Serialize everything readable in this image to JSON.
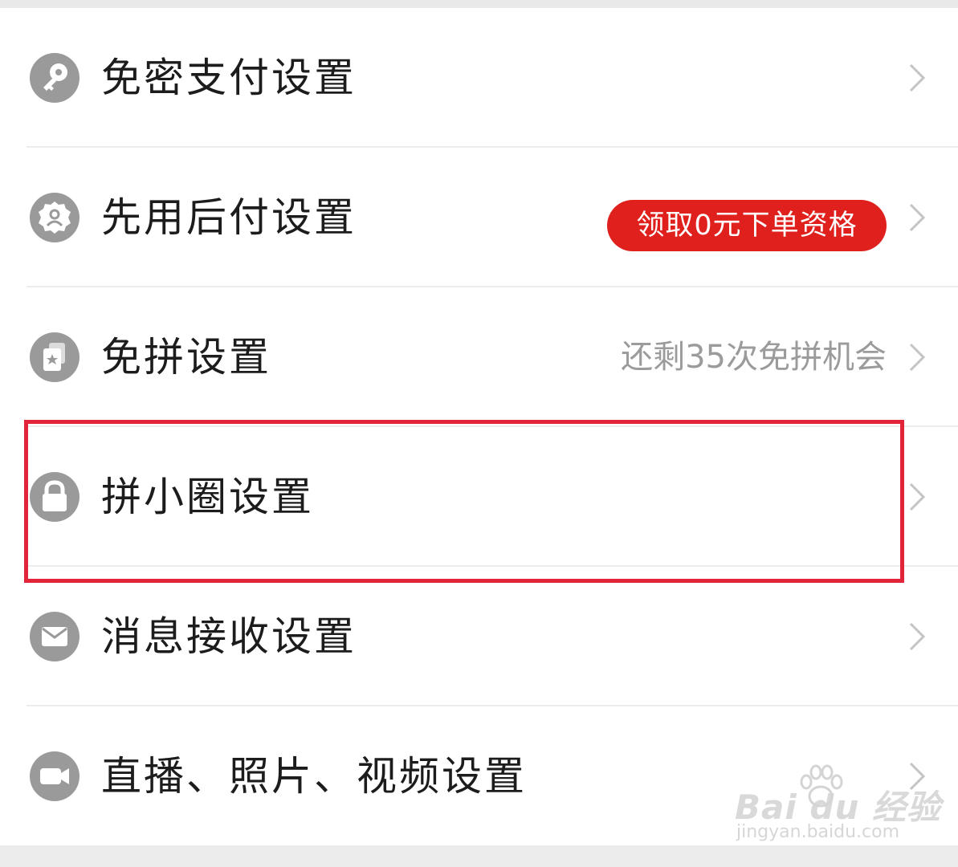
{
  "rows": [
    {
      "label": "免密支付设置",
      "icon": "key-icon"
    },
    {
      "label": "先用后付设置",
      "icon": "badge-person-icon",
      "badge": "领取0元下单资格"
    },
    {
      "label": "免拼设置",
      "icon": "star-cards-icon",
      "hint": "还剩35次免拼机会"
    },
    {
      "label": "拼小圈设置",
      "icon": "lock-icon"
    },
    {
      "label": "消息接收设置",
      "icon": "envelope-icon"
    },
    {
      "label": "直播、照片、视频设置",
      "icon": "video-camera-icon"
    }
  ],
  "watermark": {
    "logo": "Bai du 经验",
    "url": "jingyan.baidu.com"
  },
  "colors": {
    "badge": "#e0201c",
    "highlight": "#e2243a",
    "icon": "#9a9a9a",
    "hint_text": "#9b9b9b"
  }
}
